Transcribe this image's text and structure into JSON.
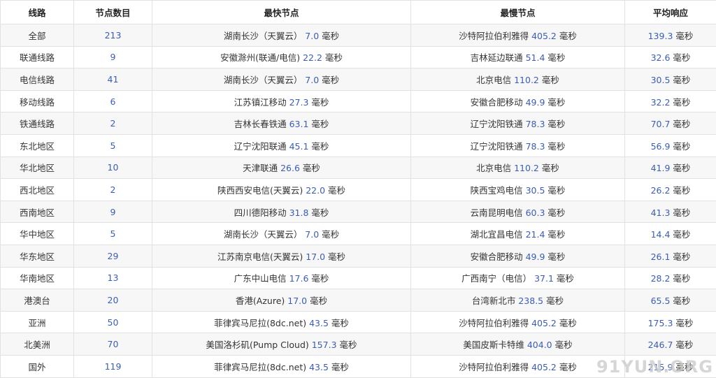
{
  "table": {
    "headers": [
      "线路",
      "节点数目",
      "最快节点",
      "最慢节点",
      "平均响应"
    ],
    "rows": [
      {
        "line": "全部",
        "count": "213",
        "fast_name": "湖南长沙（天翼云） ",
        "fast_val": "7.0",
        "slow_name": "沙特阿拉伯利雅得 ",
        "slow_val": "405.2",
        "avg_val": "139.3"
      },
      {
        "line": "联通线路",
        "count": "9",
        "fast_name": "安徽滁州(联通/电信) ",
        "fast_val": "22.2",
        "slow_name": "吉林延边联通 ",
        "slow_val": "51.4",
        "avg_val": "32.6"
      },
      {
        "line": "电信线路",
        "count": "41",
        "fast_name": "湖南长沙（天翼云） ",
        "fast_val": "7.0",
        "slow_name": "北京电信 ",
        "slow_val": "110.2",
        "avg_val": "30.5"
      },
      {
        "line": "移动线路",
        "count": "6",
        "fast_name": "江苏镇江移动 ",
        "fast_val": "27.3",
        "slow_name": "安徽合肥移动 ",
        "slow_val": "49.9",
        "avg_val": "32.2"
      },
      {
        "line": "铁通线路",
        "count": "2",
        "fast_name": "吉林长春铁通 ",
        "fast_val": "63.1",
        "slow_name": "辽宁沈阳铁通 ",
        "slow_val": "78.3",
        "avg_val": "70.7"
      },
      {
        "line": "东北地区",
        "count": "5",
        "fast_name": "辽宁沈阳联通 ",
        "fast_val": "45.1",
        "slow_name": "辽宁沈阳铁通 ",
        "slow_val": "78.3",
        "avg_val": "56.9"
      },
      {
        "line": "华北地区",
        "count": "10",
        "fast_name": "天津联通 ",
        "fast_val": "26.6",
        "slow_name": "北京电信 ",
        "slow_val": "110.2",
        "avg_val": "41.9"
      },
      {
        "line": "西北地区",
        "count": "2",
        "fast_name": "陕西西安电信(天翼云) ",
        "fast_val": "22.0",
        "slow_name": "陕西宝鸡电信 ",
        "slow_val": "30.5",
        "avg_val": "26.2"
      },
      {
        "line": "西南地区",
        "count": "9",
        "fast_name": "四川德阳移动 ",
        "fast_val": "31.8",
        "slow_name": "云南昆明电信 ",
        "slow_val": "60.3",
        "avg_val": "41.3"
      },
      {
        "line": "华中地区",
        "count": "5",
        "fast_name": "湖南长沙（天翼云） ",
        "fast_val": "7.0",
        "slow_name": "湖北宜昌电信 ",
        "slow_val": "21.4",
        "avg_val": "14.4"
      },
      {
        "line": "华东地区",
        "count": "29",
        "fast_name": "江苏南京电信(天翼云) ",
        "fast_val": "17.0",
        "slow_name": "安徽合肥移动 ",
        "slow_val": "49.9",
        "avg_val": "26.1"
      },
      {
        "line": "华南地区",
        "count": "13",
        "fast_name": "广东中山电信 ",
        "fast_val": "17.6",
        "slow_name": "广西南宁（电信） ",
        "slow_val": "37.1",
        "avg_val": "28.2"
      },
      {
        "line": "港澳台",
        "count": "20",
        "fast_name": "香港(Azure) ",
        "fast_val": "17.0",
        "slow_name": "台湾新北市 ",
        "slow_val": "238.5",
        "avg_val": "65.5"
      },
      {
        "line": "亚洲",
        "count": "50",
        "fast_name": "菲律宾马尼拉(8dc.net) ",
        "fast_val": "43.5",
        "slow_name": "沙特阿拉伯利雅得 ",
        "slow_val": "405.2",
        "avg_val": "175.3"
      },
      {
        "line": "北美洲",
        "count": "70",
        "fast_name": "美国洛杉矶(Pump Cloud) ",
        "fast_val": "157.3",
        "slow_name": "美国皮斯卡特维 ",
        "slow_val": "404.0",
        "avg_val": "246.7"
      },
      {
        "line": "国外",
        "count": "119",
        "fast_name": "菲律宾马尼拉(8dc.net) ",
        "fast_val": "43.5",
        "slow_name": "沙特阿拉伯利雅得 ",
        "slow_val": "405.2",
        "avg_val": "215.9"
      }
    ],
    "unit": " 毫秒"
  },
  "watermark": "91YUN.ORG",
  "colors": {
    "number": "#3a5db8",
    "stripe": "#f7f7f7",
    "border": "#e2e2e2"
  }
}
